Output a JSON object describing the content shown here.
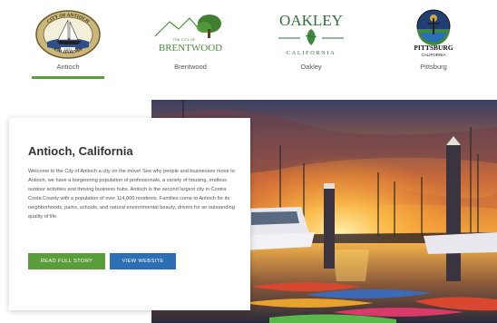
{
  "tabs": [
    {
      "label": "Antioch",
      "logo_text": [
        "CITY OF ANTIOCH",
        "CALIFORNIA",
        "1872"
      ],
      "active": true
    },
    {
      "label": "Brentwood",
      "logo_text": [
        "THE CITY OF",
        "BRENTWOOD"
      ],
      "active": false
    },
    {
      "label": "Oakley",
      "logo_text": [
        "OAKLEY",
        "CALIFORNIA"
      ],
      "active": false
    },
    {
      "label": "Pittsburg",
      "logo_text": [
        "PITTSBURG",
        "CALIFORNIA"
      ],
      "active": false
    }
  ],
  "card": {
    "title": "Antioch, California",
    "body": "Welcome to the City of Antioch a city on the move! See why people and businesses move to Antioch, we have a burgeoning population of professionals, a variety of housing, endless outdoor activities and thriving business hubs. Antioch is the second largest city in Contra Costa County with a population of over 114,000 residents. Families come to Antioch for its neighborhoods, parks, schools, and natural environmental beauty, drivers for an outstanding quality of life.",
    "read_button": "READ FULL STORY",
    "website_button": "VIEW WEBSITE"
  },
  "colors": {
    "accent_green": "#5a9e3a",
    "accent_blue": "#2d6fb5"
  }
}
